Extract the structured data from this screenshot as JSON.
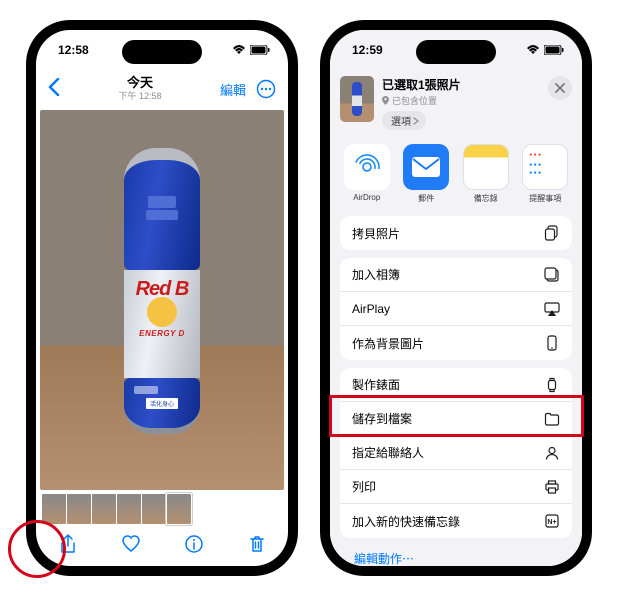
{
  "left": {
    "status": {
      "time": "12:58"
    },
    "nav": {
      "title": "今天",
      "subtitle": "下午 12:58",
      "edit": "編輯"
    },
    "photo": {
      "brand": "Red B",
      "energy": "ENERGY D",
      "label": "活化身心"
    }
  },
  "right": {
    "status": {
      "time": "12:59"
    },
    "share": {
      "title": "已選取1張照片",
      "location": "已包含位置",
      "options": "選項"
    },
    "apps": [
      {
        "label": "AirDrop"
      },
      {
        "label": "郵件"
      },
      {
        "label": "備忘錄"
      },
      {
        "label": "提醒事項"
      }
    ],
    "actions1": [
      {
        "label": "拷貝照片",
        "icon": "copy"
      }
    ],
    "actions2": [
      {
        "label": "加入相簿",
        "icon": "album"
      },
      {
        "label": "AirPlay",
        "icon": "airplay"
      },
      {
        "label": "作為背景圖片",
        "icon": "wallpaper"
      }
    ],
    "actions3": [
      {
        "label": "製作錶面",
        "icon": "watch"
      },
      {
        "label": "儲存到檔案",
        "icon": "folder"
      },
      {
        "label": "指定給聯絡人",
        "icon": "contact"
      },
      {
        "label": "列印",
        "icon": "print"
      },
      {
        "label": "加入新的快速備忘錄",
        "icon": "quicknote"
      }
    ],
    "editActions": "編輯動作⋯"
  }
}
